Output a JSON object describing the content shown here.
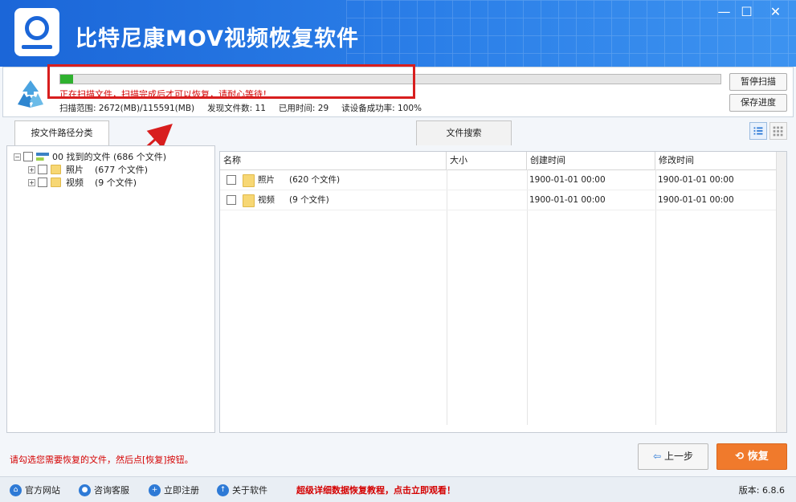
{
  "app": {
    "title": "比特尼康MOV视频恢复软件"
  },
  "window_controls": {
    "minimize": "—",
    "maximize": "☐",
    "close": "✕"
  },
  "scan": {
    "progress_fraction": 0.02,
    "warning": "正在扫描文件，扫描完成后才可以恢复，请耐心等待！",
    "range": "扫描范围: 2672(MB)/115591(MB)",
    "found": "发现文件数: 11",
    "elapsed": "已用时间: 29",
    "success_rate": "读设备成功率: 100%",
    "pause_label": "暂停扫描",
    "save_label": "保存进度"
  },
  "tabs": {
    "path_tab": "按文件路径分类",
    "search_tab": "文件搜索"
  },
  "tree": {
    "root": {
      "prefix": "00",
      "label": "找到的文件",
      "count": "(686 个文件)"
    },
    "children": [
      {
        "label": "照片",
        "count": "(677 个文件)"
      },
      {
        "label": "视频",
        "count": "(9 个文件)"
      }
    ]
  },
  "table": {
    "headers": [
      "名称",
      "大小",
      "创建时间",
      "修改时间"
    ],
    "rows": [
      {
        "name": "照片",
        "count": "(620 个文件)",
        "size": "",
        "created": "1900-01-01  00:00",
        "modified": "1900-01-01  00:00"
      },
      {
        "name": "视频",
        "count": "(9 个文件)",
        "size": "",
        "created": "1900-01-01  00:00",
        "modified": "1900-01-01  00:00"
      }
    ]
  },
  "bottom": {
    "hint": "请勾选您需要恢复的文件，然后点[恢复]按钮。",
    "prev_label": "上一步",
    "recover_label": "恢复"
  },
  "footer": {
    "links": [
      "官方网站",
      "咨询客服",
      "立即注册",
      "关于软件"
    ],
    "promo": "超级详细数据恢复教程，点击立即观看！",
    "version": "版本: 6.8.6"
  },
  "colors": {
    "accent": "#1b66d8",
    "progress": "#2fb12f",
    "warning": "#d40000",
    "recover": "#f07a2c",
    "annotation": "#d81e1e"
  }
}
